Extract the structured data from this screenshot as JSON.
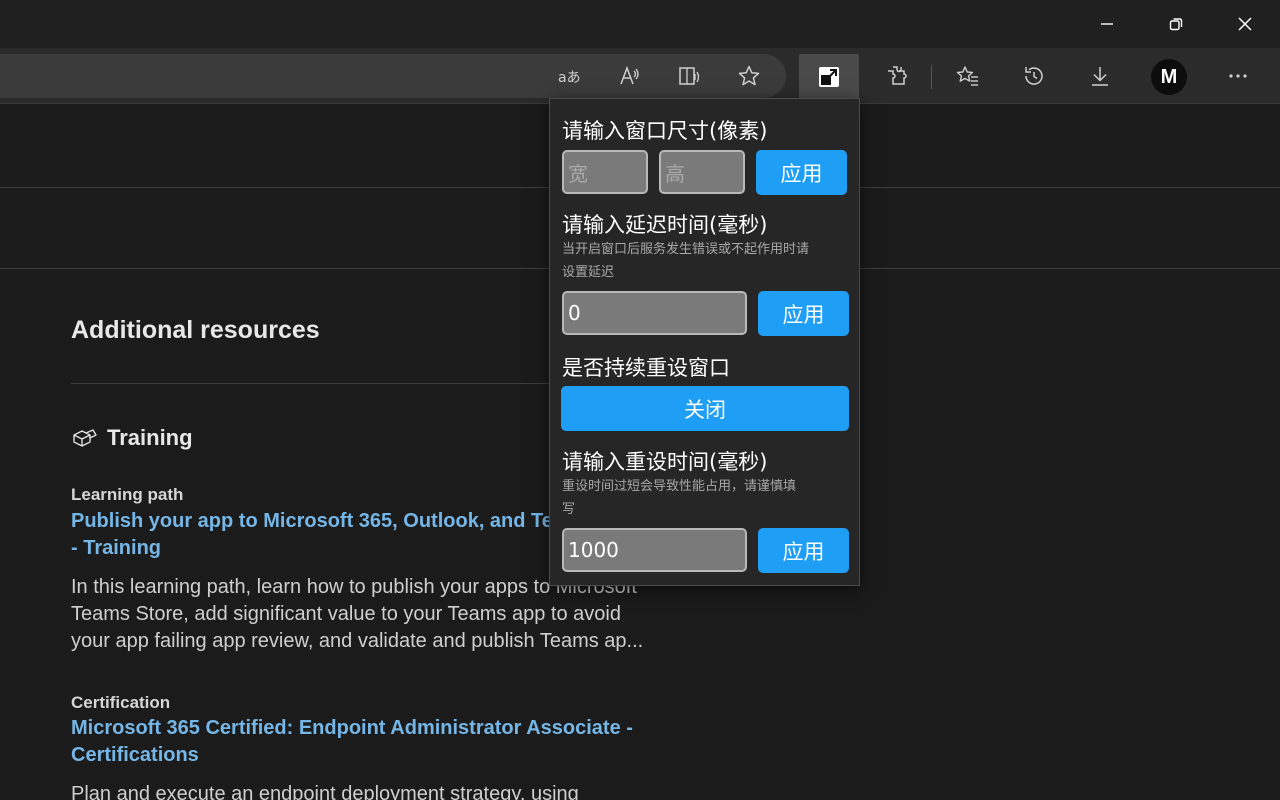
{
  "window": {
    "minimize_icon": "minimize-icon",
    "restore_icon": "restore-icon",
    "close_icon": "close-icon"
  },
  "toolbar": {
    "icons": [
      "translate-icon",
      "read-aloud-icon",
      "immersive-reader-icon",
      "favorite-star-icon",
      "resize-window-extension-icon",
      "extensions-puzzle-icon",
      "favorites-icon",
      "history-icon",
      "downloads-icon",
      "profile-avatar",
      "more-options-icon"
    ],
    "avatar_letter": "M"
  },
  "page": {
    "section_title": "Additional resources",
    "training_heading": "Training",
    "items": [
      {
        "kind": "Learning path",
        "link_line1": "Publish your app to Microsoft 365, Outlook, and Te",
        "link_line2": "- Training",
        "desc_line1": "In this learning path, learn how to publish your apps to Microsoft",
        "desc_line2": "Teams Store, add significant value to your Teams app to avoid",
        "desc_line3": "your app failing app review, and validate and publish Teams ap..."
      },
      {
        "kind": "Certification",
        "link_line1": "Microsoft 365 Certified: Endpoint Administrator Associate -",
        "link_line2": "Certifications",
        "desc_line1": "Plan and execute an endpoint deployment strategy, using"
      }
    ]
  },
  "popup": {
    "size_label": "请输入窗口尺寸(像素)",
    "width_placeholder": "宽",
    "height_placeholder": "高",
    "apply_label": "应用",
    "delay_label": "请输入延迟时间(毫秒)",
    "delay_hint_line1": "当开启窗口后服务发生错误或不起作用时请",
    "delay_hint_line2": "设置延迟",
    "delay_value": "0",
    "persist_label": "是否持续重设窗口",
    "persist_toggle": "关闭",
    "reset_label": "请输入重设时间(毫秒)",
    "reset_hint_line1": "重设时间过短会导致性能占用，请谨慎填",
    "reset_hint_line2": "写",
    "reset_value": "1000"
  },
  "colors": {
    "accent_button": "#1e9ff5",
    "link": "#75b6e7",
    "background": "#1b1b1b"
  }
}
